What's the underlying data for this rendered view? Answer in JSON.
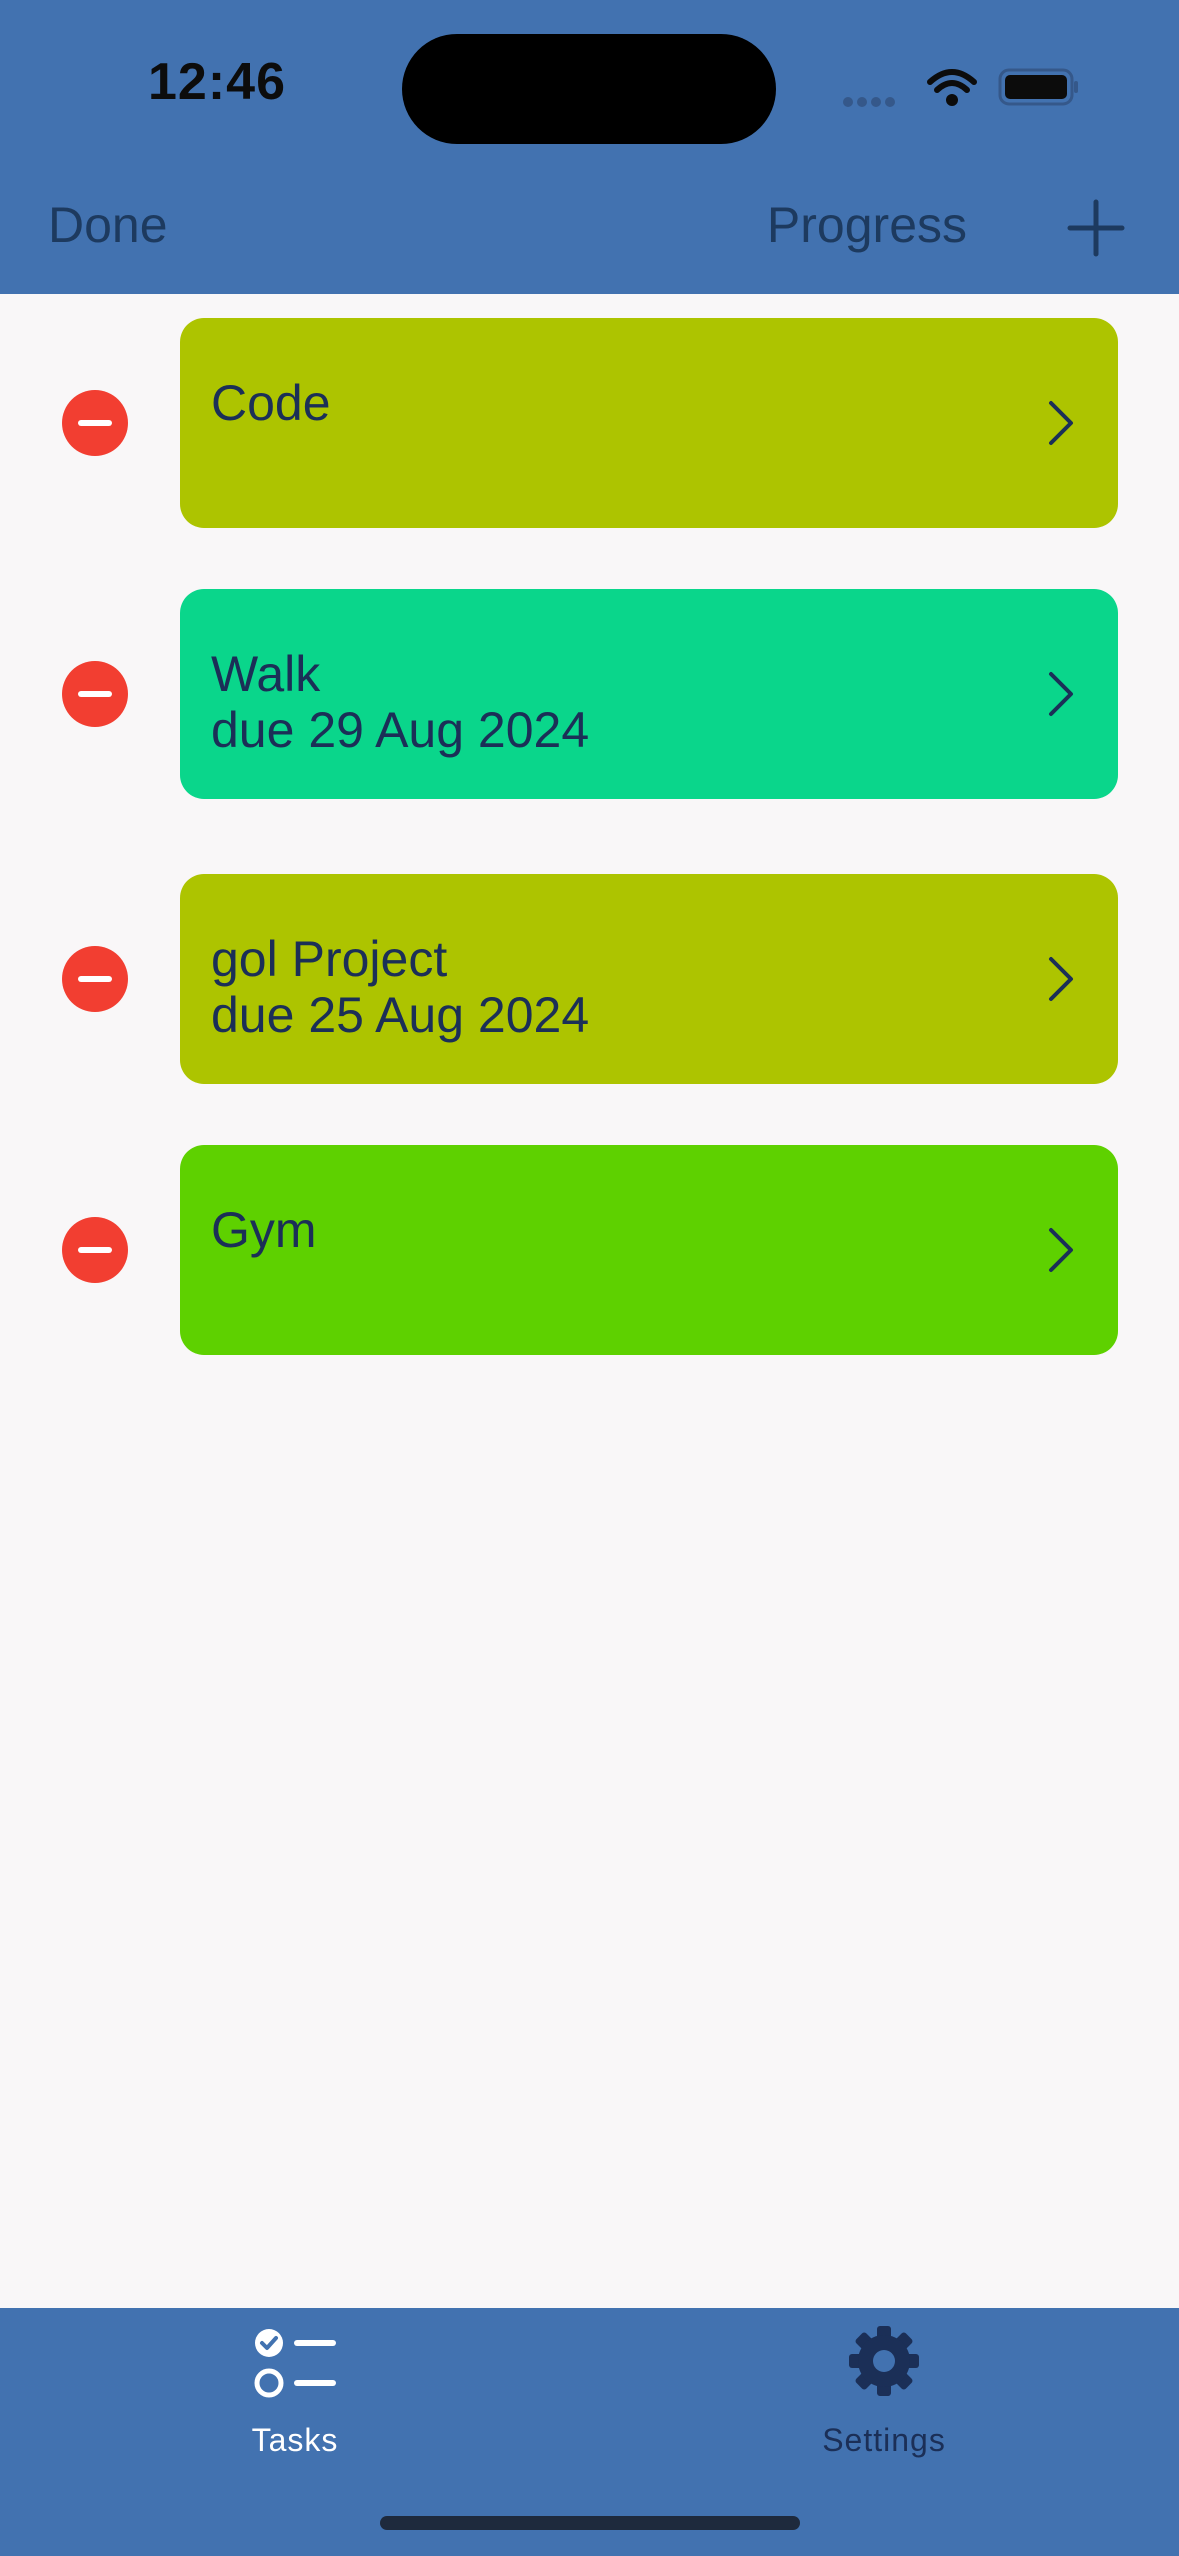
{
  "status_bar": {
    "time": "12:46"
  },
  "nav_bar": {
    "left_label": "Done",
    "progress_label": "Progress",
    "add_icon": "plus-icon"
  },
  "tasks": [
    {
      "title": "Code",
      "due": "",
      "color": "#adc400"
    },
    {
      "title": "Walk",
      "due": "due 29 Aug 2024",
      "color": "#0ad68b"
    },
    {
      "title": "gol Project",
      "due": "due 25 Aug 2024",
      "color": "#adc400"
    },
    {
      "title": "Gym",
      "due": "",
      "color": "#5ed100"
    }
  ],
  "tab_bar": {
    "tasks_label": "Tasks",
    "settings_label": "Settings",
    "tasks_icon": "checklist-icon",
    "settings_icon": "gear-icon"
  },
  "colors": {
    "header_bg": "#4272b0",
    "nav_text": "#1d3a5f",
    "delete_red": "#f23e31",
    "card_text": "#1b2f57",
    "tab_selected": "#ffffff",
    "tab_unselected": "#1b2f57"
  }
}
